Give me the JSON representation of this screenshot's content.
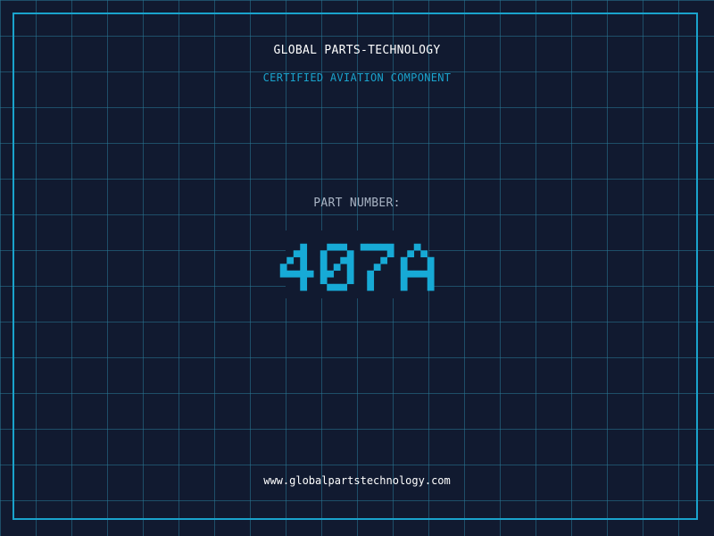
{
  "header": {
    "company": "GLOBAL PARTS-TECHNOLOGY",
    "certification": "CERTIFIED AVIATION COMPONENT"
  },
  "part": {
    "label": "PART NUMBER:",
    "number": "407A"
  },
  "footer": {
    "website": "www.globalpartstechnology.com"
  },
  "colors": {
    "background": "#111a30",
    "grid": "#1f5f78",
    "accent": "#1aa3cc",
    "number": "#17aad6",
    "text": "#ffffff",
    "label": "#a9b4c4"
  }
}
